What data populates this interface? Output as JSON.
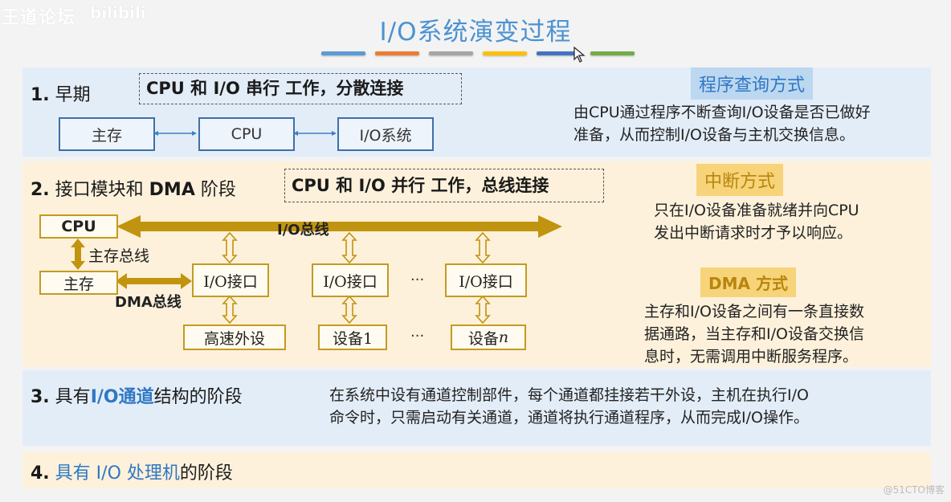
{
  "watermark": {
    "forum": "王道论坛",
    "logo": "bilibili",
    "corner": "@51CTO博客"
  },
  "title": "I/O系统演变过程",
  "title_bar_colors": [
    "#5b9bd5",
    "#ed7d31",
    "#a5a5a5",
    "#ffc000",
    "#4472c4",
    "#70ad47"
  ],
  "stages": [
    {
      "number": "1.",
      "label": "早期",
      "summary": "CPU 和 I/O  串行 工作，分散连接",
      "diagram": {
        "nodes": [
          "主存",
          "CPU",
          "I/O系统"
        ]
      },
      "method": {
        "title": "程序查询方式",
        "lines": [
          "由CPU通过程序不断查询I/O设备是否已做好",
          "准备，从而控制I/O设备与主机交换信息。"
        ]
      }
    },
    {
      "number": "2.",
      "label_pre": "接口模块和 ",
      "label_bold": "DMA",
      "label_post": " 阶段",
      "summary": "CPU 和 I/O  并行 工作，总线连接",
      "diagram": {
        "cpu": "CPU",
        "memory": "主存",
        "io_bus": "I/O总线",
        "mem_bus": "主存总线",
        "dma_bus": "DMA总线",
        "interfaces": [
          "I/O接口",
          "I/O接口",
          "I/O接口"
        ],
        "devices": [
          "高速外设",
          "设备1",
          "设备n"
        ],
        "ellipsis": "···"
      },
      "methods": [
        {
          "title": "中断方式",
          "lines": [
            "只在I/O设备准备就绪并向CPU",
            "发出中断请求时才予以响应。"
          ]
        },
        {
          "title": "DMA 方式",
          "lines": [
            "主存和I/O设备之间有一条直接数",
            "据通路，当主存和I/O设备交换信",
            "息时，无需调用中断服务程序。"
          ]
        }
      ]
    },
    {
      "number": "3.",
      "label_pre": "具有",
      "label_highlight": "I/O通道",
      "label_post": "结构的阶段",
      "description": [
        "在系统中设有通道控制部件，每个通道都挂接若干外设，主机在执行I/O",
        "命令时，只需启动有关通道，通道将执行通道程序，从而完成I/O操作。"
      ]
    },
    {
      "number": "4.",
      "label_highlight": "具有 I/O 处理机",
      "label_post": "的阶段"
    }
  ]
}
